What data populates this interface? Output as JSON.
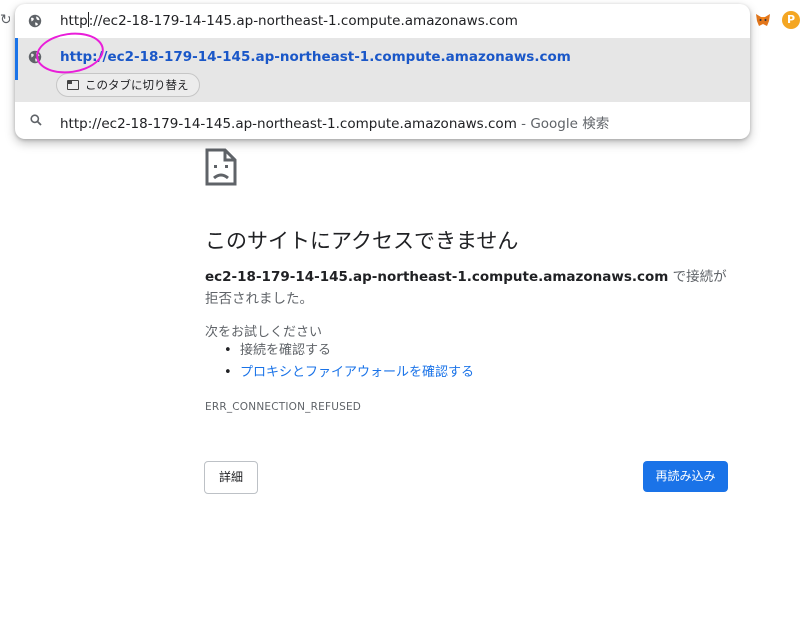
{
  "browser": {
    "reload_glyph": "↻",
    "extension_p_label": "P"
  },
  "omnibox": {
    "input_value": "http://ec2-18-179-14-145.ap-northeast-1.compute.amazonaws.com",
    "input_before_caret": "http",
    "input_after_caret": "://ec2-18-179-14-145.ap-northeast-1.compute.amazonaws.com",
    "suggestions": [
      {
        "icon": "globe-icon",
        "text": "http://ec2-18-179-14-145.ap-northeast-1.compute.amazonaws.com",
        "action_label": "このタブに切り替え"
      },
      {
        "icon": "search-icon",
        "text": "http://ec2-18-179-14-145.ap-northeast-1.compute.amazonaws.com",
        "suffix": " - Google 検索"
      }
    ]
  },
  "error_page": {
    "title": "このサイトにアクセスできません",
    "host": "ec2-18-179-14-145.ap-northeast-1.compute.amazonaws.com",
    "description_suffix": " で接続が拒否されました。",
    "try_label": "次をお試しください",
    "suggestions": [
      {
        "text": "接続を確認する"
      },
      {
        "text": "プロキシとファイアウォールを確認する"
      }
    ],
    "error_code": "ERR_CONNECTION_REFUSED",
    "details_button": "詳細",
    "reload_button": "再読み込み"
  },
  "colors": {
    "accent": "#1a73e8",
    "selected_row_bg": "#e6e6e6",
    "annotation": "#e91ed9"
  }
}
